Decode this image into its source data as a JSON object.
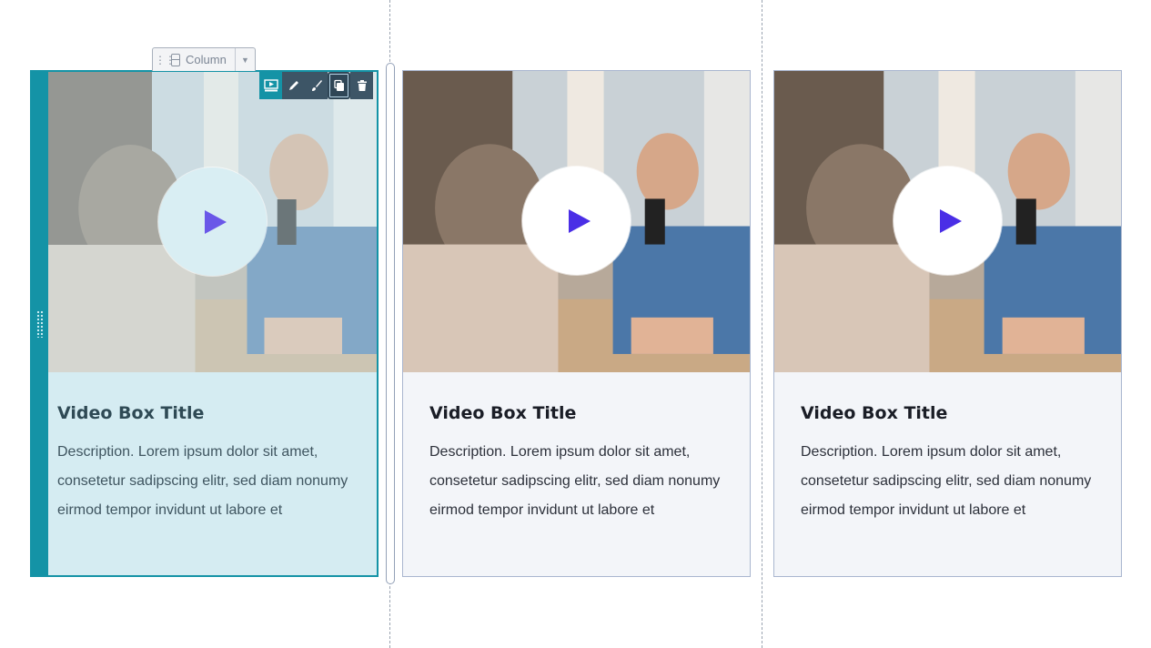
{
  "column_chip": {
    "label": "Column",
    "drag_icon": "drag-handle-icon",
    "column_icon": "column-layout-icon",
    "caret_icon": "chevron-down-icon"
  },
  "toolbar": {
    "buttons": [
      {
        "name": "video-box-widget-icon"
      },
      {
        "name": "edit-pencil-icon"
      },
      {
        "name": "style-brush-icon"
      },
      {
        "name": "duplicate-icon"
      },
      {
        "name": "delete-trash-icon"
      }
    ]
  },
  "colors": {
    "accent": "#1493a6",
    "play_triangle": "#4a2ee6",
    "card_bg": "#f3f5f9",
    "card_border": "#a9b6cf"
  },
  "cards": [
    {
      "title": "Video Box Title",
      "description": "Description. Lorem ipsum dolor sit amet, consetetur sadipscing elitr, sed diam nonumy eirmod tempor invidunt ut labore et",
      "selected": true
    },
    {
      "title": "Video Box Title",
      "description": "Description. Lorem ipsum dolor sit amet, consetetur sadipscing elitr, sed diam nonumy eirmod tempor invidunt ut labore et",
      "selected": false
    },
    {
      "title": "Video Box Title",
      "description": "Description. Lorem ipsum dolor sit amet, consetetur sadipscing elitr, sed diam nonumy eirmod tempor invidunt ut labore et",
      "selected": false
    }
  ]
}
